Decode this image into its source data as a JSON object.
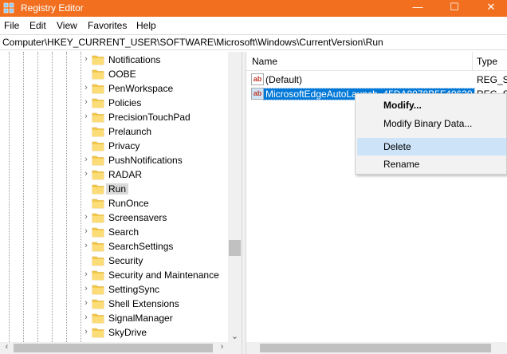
{
  "window": {
    "title": "Registry Editor",
    "controls": {
      "minimize": "—",
      "maximize": "☐",
      "close": "✕"
    }
  },
  "menu": [
    "File",
    "Edit",
    "View",
    "Favorites",
    "Help"
  ],
  "address": "Computer\\HKEY_CURRENT_USER\\SOFTWARE\\Microsoft\\Windows\\CurrentVersion\\Run",
  "tree": {
    "items": [
      {
        "label": "Notifications",
        "expandable": true
      },
      {
        "label": "OOBE",
        "expandable": false
      },
      {
        "label": "PenWorkspace",
        "expandable": true
      },
      {
        "label": "Policies",
        "expandable": true
      },
      {
        "label": "PrecisionTouchPad",
        "expandable": true
      },
      {
        "label": "Prelaunch",
        "expandable": false
      },
      {
        "label": "Privacy",
        "expandable": false
      },
      {
        "label": "PushNotifications",
        "expandable": true
      },
      {
        "label": "RADAR",
        "expandable": true
      },
      {
        "label": "Run",
        "expandable": false,
        "selected": true
      },
      {
        "label": "RunOnce",
        "expandable": false
      },
      {
        "label": "Screensavers",
        "expandable": true
      },
      {
        "label": "Search",
        "expandable": true
      },
      {
        "label": "SearchSettings",
        "expandable": true
      },
      {
        "label": "Security",
        "expandable": false
      },
      {
        "label": "Security and Maintenance",
        "expandable": true
      },
      {
        "label": "SettingSync",
        "expandable": true
      },
      {
        "label": "Shell Extensions",
        "expandable": true
      },
      {
        "label": "SignalManager",
        "expandable": true
      },
      {
        "label": "SkyDrive",
        "expandable": true
      }
    ]
  },
  "list": {
    "columns": {
      "name": "Name",
      "type": "Type"
    },
    "rows": [
      {
        "name": "(Default)",
        "type": "REG_SZ",
        "icon": "ab"
      },
      {
        "name": "MicrosoftEdgeAutoLaunch_45DA8078B5F40620",
        "type": "REG_SZ",
        "icon": "ab",
        "selected": true
      }
    ]
  },
  "context_menu": {
    "items": [
      {
        "label": "Modify...",
        "bold": true
      },
      {
        "label": "Modify Binary Data..."
      },
      {
        "label": "Delete",
        "highlighted": true
      },
      {
        "label": "Rename"
      }
    ]
  },
  "colors": {
    "titlebar": "#f16f1f",
    "selection": "#0078d7",
    "menu_highlight": "#cde3f7",
    "folder": "#f3c94a"
  }
}
